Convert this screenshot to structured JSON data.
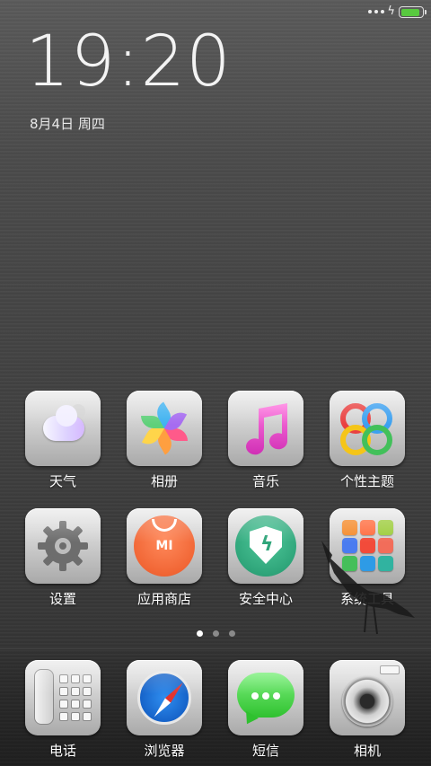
{
  "status_bar": {
    "battery_level": 0.9
  },
  "lock": {
    "time": "19:20",
    "date": "8月4日 周四"
  },
  "apps": [
    {
      "label": "天气",
      "icon": "weather-icon"
    },
    {
      "label": "相册",
      "icon": "gallery-icon"
    },
    {
      "label": "音乐",
      "icon": "music-icon"
    },
    {
      "label": "个性主题",
      "icon": "themes-icon"
    },
    {
      "label": "设置",
      "icon": "settings-icon"
    },
    {
      "label": "应用商店",
      "icon": "app-store-icon"
    },
    {
      "label": "安全中心",
      "icon": "security-icon"
    },
    {
      "label": "系统工具",
      "icon": "system-tools-folder-icon"
    }
  ],
  "store_logo": "MI",
  "pager": {
    "pages": 3,
    "current": 0
  },
  "dock": [
    {
      "label": "电话",
      "icon": "phone-icon"
    },
    {
      "label": "浏览器",
      "icon": "browser-icon"
    },
    {
      "label": "短信",
      "icon": "messages-icon"
    },
    {
      "label": "相机",
      "icon": "camera-icon"
    }
  ],
  "colors": {
    "battery": "#58c93f",
    "store": "#f16635",
    "security": "#2fa57a",
    "messages": "#2fc12f"
  }
}
